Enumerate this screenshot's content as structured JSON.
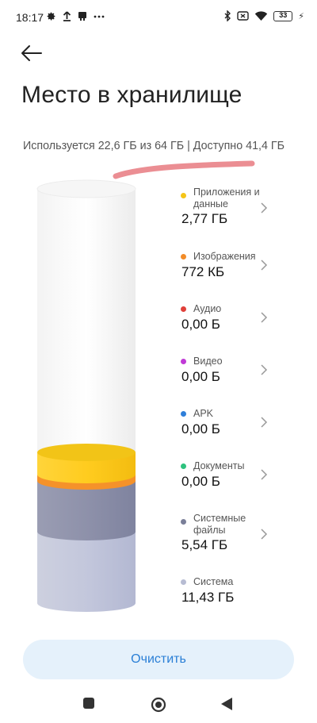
{
  "status_bar": {
    "time": "18:17",
    "battery_level": "33"
  },
  "page": {
    "title": "Место в хранилище",
    "usage_text": "Используется 22,6 ГБ из 64 ГБ | Доступно 41,4 ГБ"
  },
  "categories": [
    {
      "label": "Приложения и данные",
      "size": "2,77 ГБ",
      "color": "#f5c518"
    },
    {
      "label": "Изображения",
      "size": "772 КБ",
      "color": "#f28c28"
    },
    {
      "label": "Аудио",
      "size": "0,00 Б",
      "color": "#e0403a"
    },
    {
      "label": "Видео",
      "size": "0,00 Б",
      "color": "#c03ad6"
    },
    {
      "label": "APK",
      "size": "0,00 Б",
      "color": "#2f7fd9"
    },
    {
      "label": "Документы",
      "size": "0,00 Б",
      "color": "#2ec27e"
    },
    {
      "label": "Системные файлы",
      "size": "5,54 ГБ",
      "color": "#7a7f99"
    },
    {
      "label": "Система",
      "size": "11,43 ГБ",
      "color": "#b7bcd3"
    }
  ],
  "actions": {
    "clear_label": "Очистить"
  }
}
